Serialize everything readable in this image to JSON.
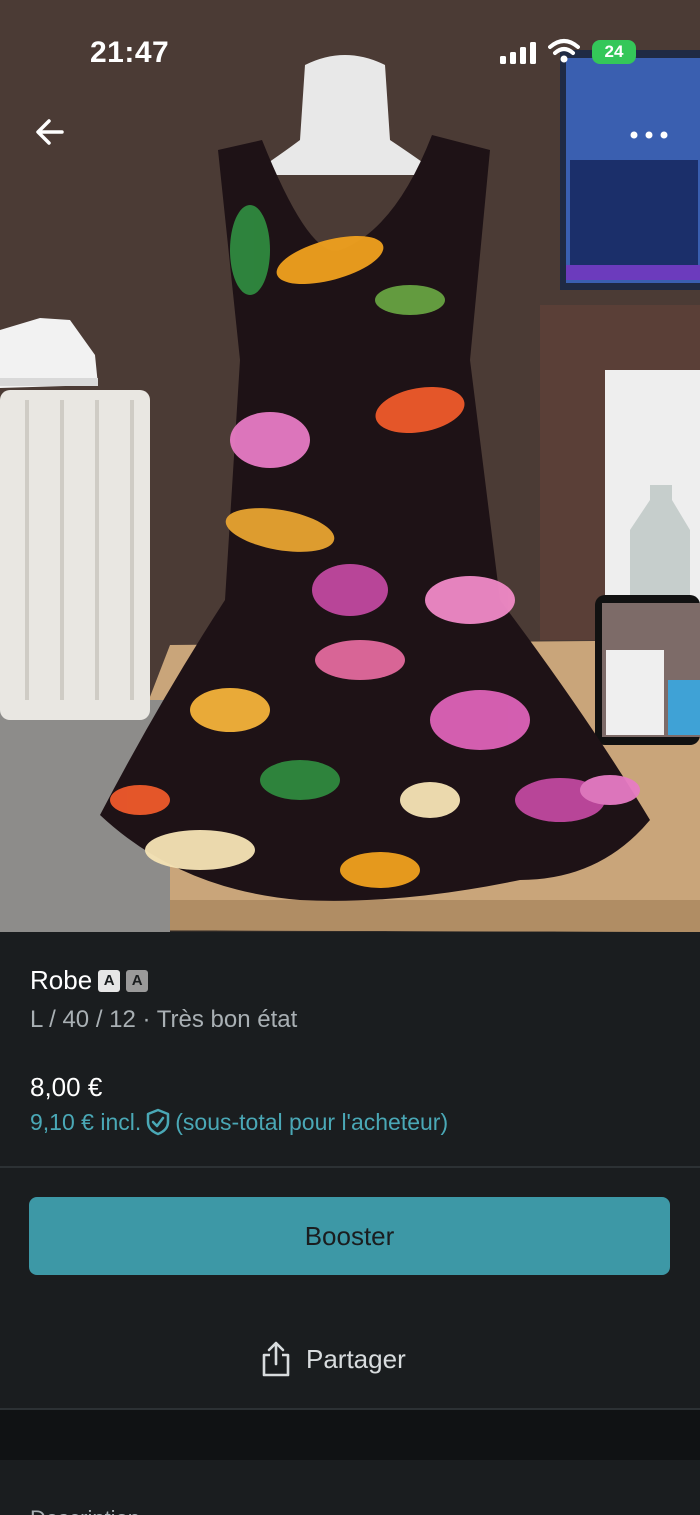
{
  "status_bar": {
    "time": "21:47",
    "battery": "24"
  },
  "photo": {
    "description_alt": ""
  },
  "listing": {
    "title": "Robe",
    "badge_primary": "A",
    "badge_secondary": "A",
    "details": "L / 40 / 12 · Très bon état",
    "price": "8,00 €",
    "buyer_total_amount": "9,10 € incl.",
    "buyer_total_note": "(sous-total pour l'acheteur)"
  },
  "actions": {
    "booster_label": "Booster",
    "share_label": "Partager"
  },
  "description": {
    "heading": "Description"
  },
  "colors": {
    "accent": "#3d98a6",
    "link": "#4aa8b6",
    "background": "#1a1d1f",
    "battery": "#34c759"
  }
}
